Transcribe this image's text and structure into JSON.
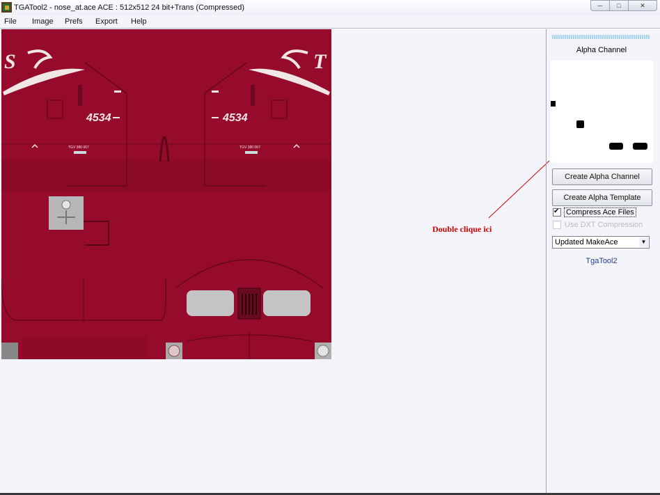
{
  "window": {
    "title": "TGATool2 - nose_at.ace  ACE : 512x512 24 bit+Trans (Compressed)",
    "controls": [
      "minimize-icon",
      "maximize-icon",
      "close-icon"
    ]
  },
  "menu": [
    "File",
    "Image",
    "Prefs",
    "Export",
    "Help"
  ],
  "texture": {
    "letters": [
      "S",
      "T"
    ],
    "numbers": [
      "4534",
      "4534"
    ],
    "small_text": [
      "TGV 380 067",
      "TGV 380 067"
    ],
    "base_color": "#960b2b"
  },
  "panel": {
    "alpha_title": "Alpha Channel",
    "create_alpha_channel": "Create Alpha Channel",
    "create_alpha_template": "Create Alpha Template",
    "compress_ace": {
      "label": "Compress Ace Files",
      "checked": true
    },
    "use_dxt": {
      "label": "Use DXT Compression",
      "checked": false,
      "enabled": false
    },
    "converter": {
      "selected": "Updated MakeAce"
    },
    "footer": "TgaTool2"
  },
  "annotation": {
    "text": "Double clique ici",
    "color": "#d40000"
  }
}
